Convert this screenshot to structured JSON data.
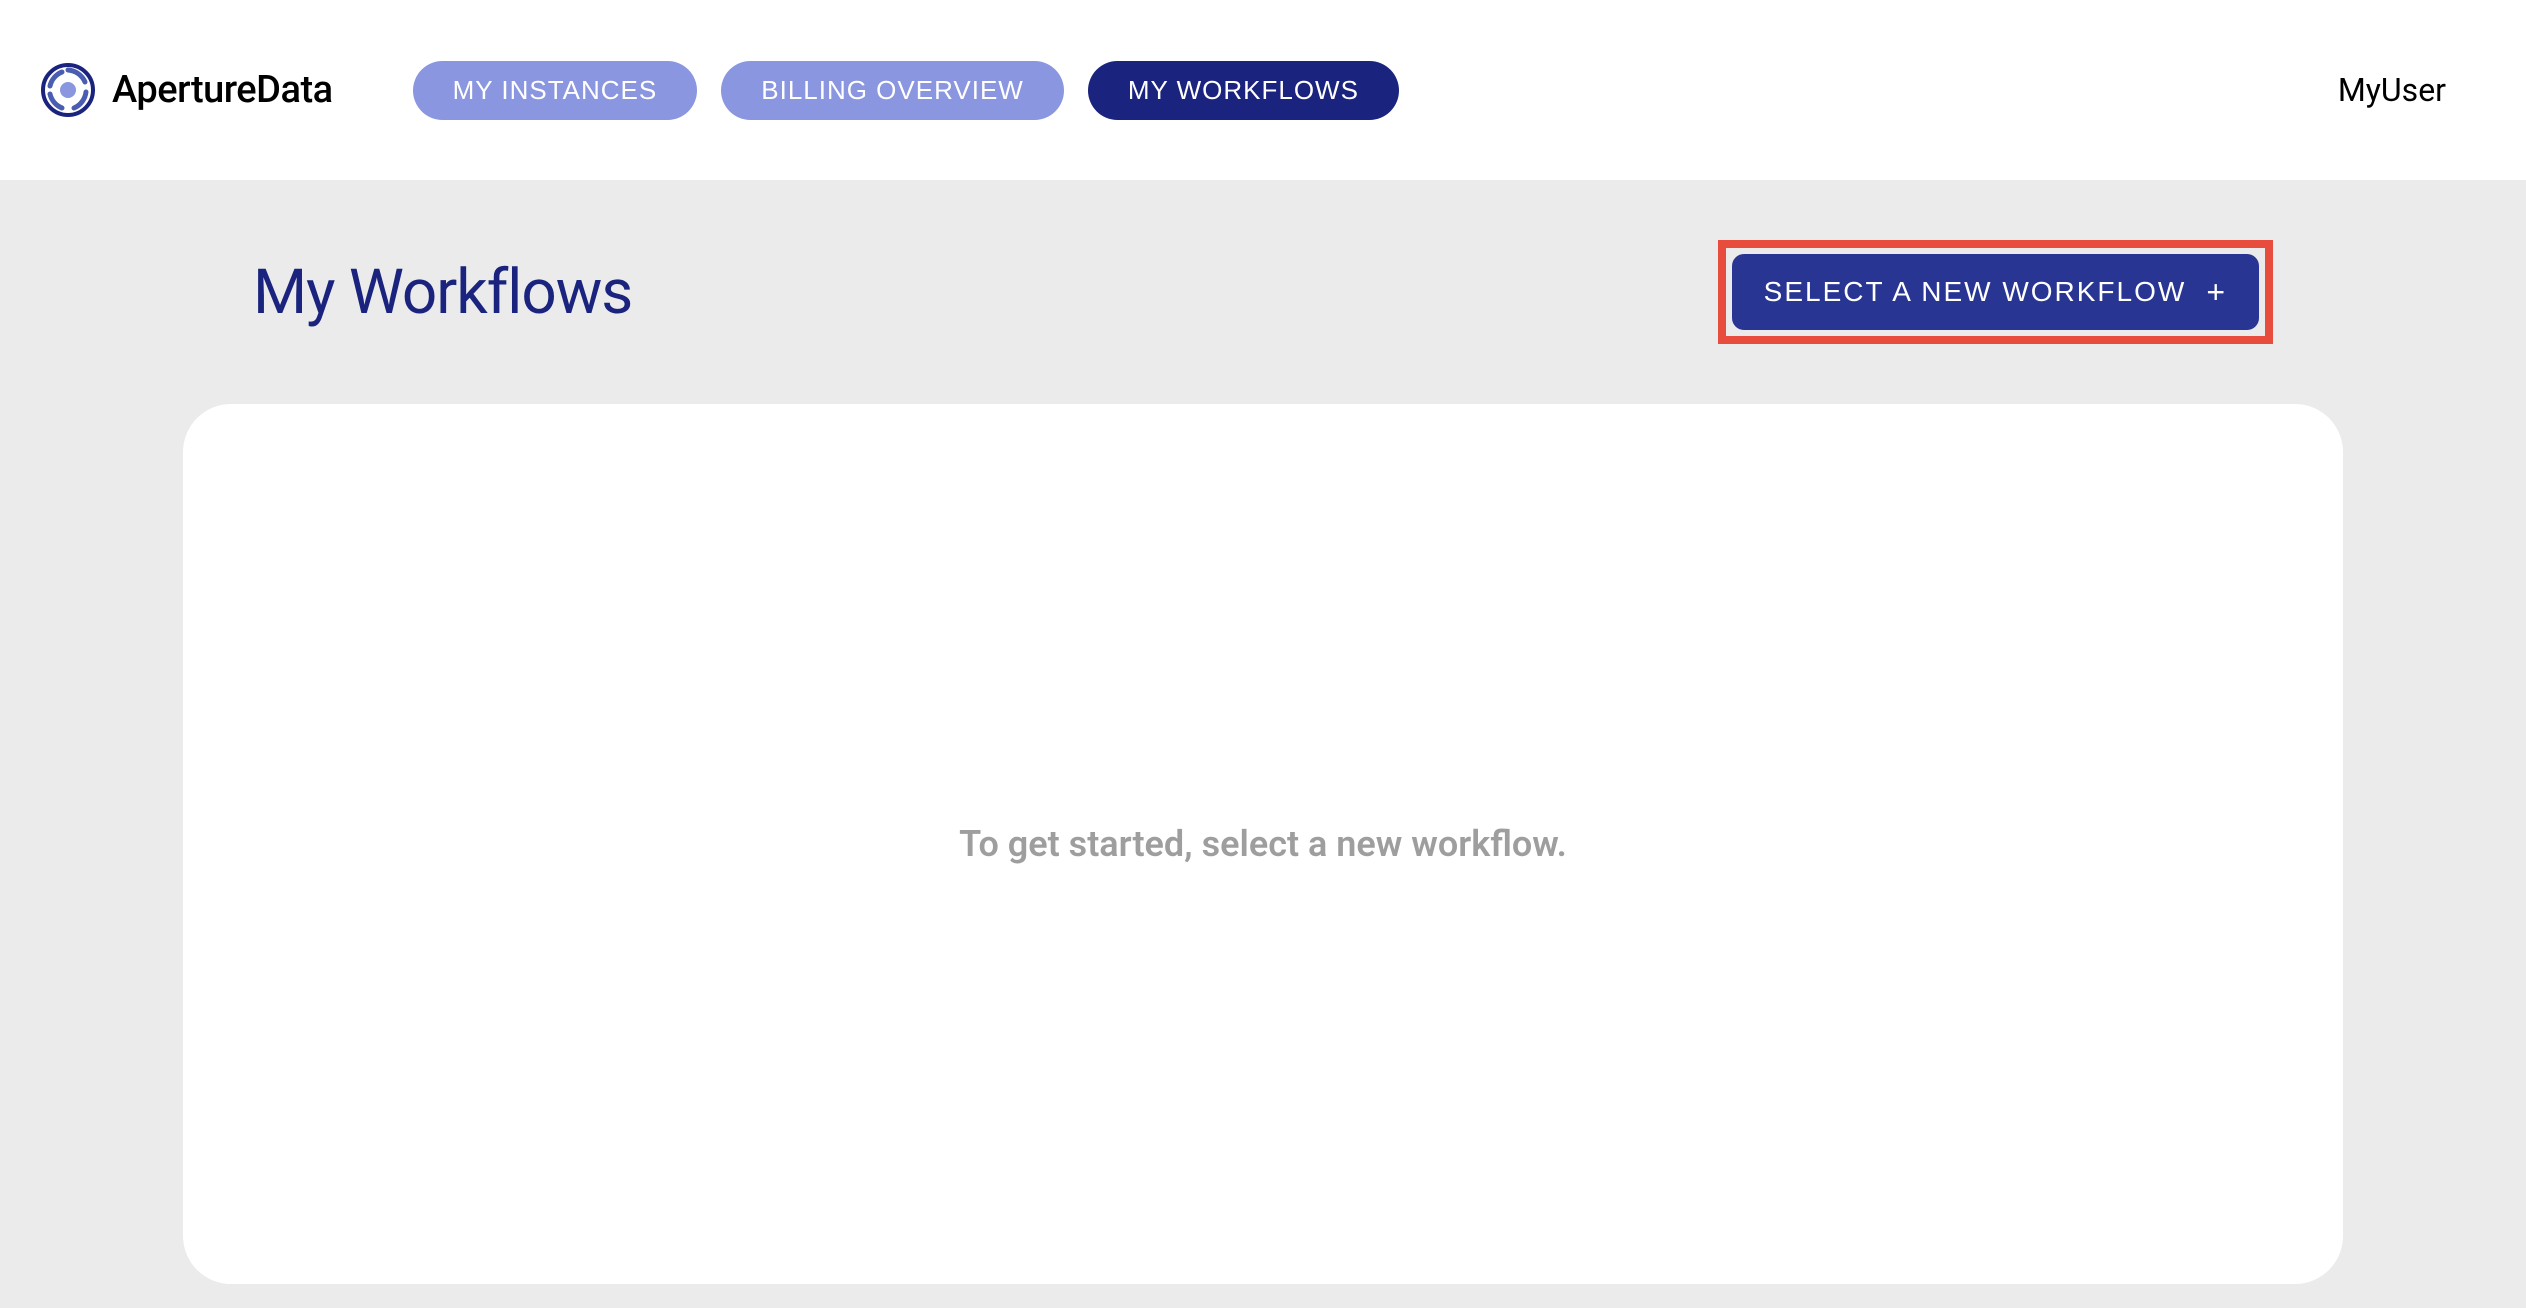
{
  "brand": {
    "name": "ApertureData"
  },
  "nav": {
    "tabs": [
      {
        "label": "MY INSTANCES",
        "active": false
      },
      {
        "label": "BILLING OVERVIEW",
        "active": false
      },
      {
        "label": "MY WORKFLOWS",
        "active": true
      }
    ]
  },
  "user": {
    "display_name": "MyUser"
  },
  "page": {
    "title": "My Workflows",
    "primary_action": "SELECT A NEW WORKFLOW",
    "empty_state_message": "To get started, select a new workflow."
  },
  "colors": {
    "brand_dark": "#1a237e",
    "brand_light": "#8a96e0",
    "highlight": "#e74c3c"
  }
}
